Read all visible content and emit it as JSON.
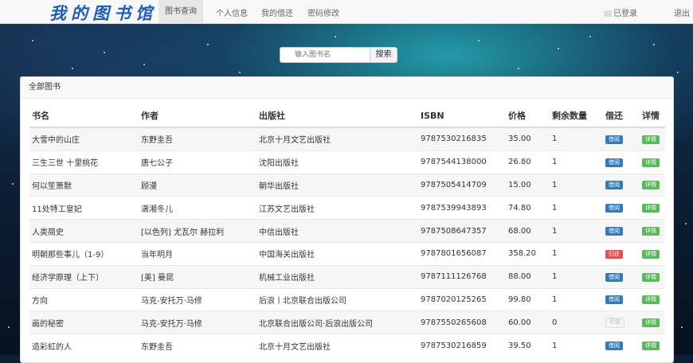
{
  "nav": {
    "brand": "我的图书馆",
    "links": [
      "图书查询",
      "个人信息",
      "我的借还",
      "密码修改"
    ],
    "user_status": "已登录",
    "logout": "退出"
  },
  "search": {
    "placeholder": "输入图书名",
    "button": "搜索"
  },
  "panel": {
    "title": "全部图书"
  },
  "table": {
    "headers": [
      "书名",
      "作者",
      "出版社",
      "ISBN",
      "价格",
      "剩余数量",
      "借还",
      "详情"
    ],
    "rows": [
      {
        "title": "大雪中的山庄",
        "author": "东野圭吾",
        "publisher": "北京十月文艺出版社",
        "isbn": "9787530216835",
        "price": "35.00",
        "stock": "1",
        "action": "借阅",
        "action_type": "borrow",
        "detail": "详情"
      },
      {
        "title": "三生三世 十里桃花",
        "author": "唐七公子",
        "publisher": "沈阳出版社",
        "isbn": "9787544138000",
        "price": "26.80",
        "stock": "1",
        "action": "借阅",
        "action_type": "borrow",
        "detail": "详情"
      },
      {
        "title": "何以笙箫默",
        "author": "顾漫",
        "publisher": "朝华出版社",
        "isbn": "9787505414709",
        "price": "15.00",
        "stock": "1",
        "action": "借阅",
        "action_type": "borrow",
        "detail": "详情"
      },
      {
        "title": "11处特工皇妃",
        "author": "潇湘冬儿",
        "publisher": "江苏文艺出版社",
        "isbn": "9787539943893",
        "price": "74.80",
        "stock": "1",
        "action": "借阅",
        "action_type": "borrow",
        "detail": "详情"
      },
      {
        "title": "人类简史",
        "author": "[以色列] 尤瓦尔 赫拉利",
        "publisher": "中信出版社",
        "isbn": "9787508647357",
        "price": "68.00",
        "stock": "1",
        "action": "借阅",
        "action_type": "borrow",
        "detail": "详情"
      },
      {
        "title": "明朝那些事儿（1-9）",
        "author": "当年明月",
        "publisher": "中国海关出版社",
        "isbn": "9787801656087",
        "price": "358.20",
        "stock": "1",
        "action": "归还",
        "action_type": "return",
        "detail": "详情"
      },
      {
        "title": "经济学原理（上下）",
        "author": "[美] 曼昆",
        "publisher": "机械工业出版社",
        "isbn": "9787111126768",
        "price": "88.00",
        "stock": "1",
        "action": "借阅",
        "action_type": "borrow",
        "detail": "详情"
      },
      {
        "title": "方向",
        "author": "马克-安托万·马修",
        "publisher": "后浪丨北京联合出版公司",
        "isbn": "9787020125265",
        "price": "99.80",
        "stock": "1",
        "action": "借阅",
        "action_type": "borrow",
        "detail": "详情"
      },
      {
        "title": "画的秘密",
        "author": "马克-安托万·马修",
        "publisher": "北京联合出版公司·后浪出版公司",
        "isbn": "9787550265608",
        "price": "60.00",
        "stock": "0",
        "action": "已空",
        "action_type": "empty",
        "detail": "详情"
      },
      {
        "title": "造彩虹的人",
        "author": "东野圭吾",
        "publisher": "北京十月文艺出版社",
        "isbn": "9787530216859",
        "price": "39.50",
        "stock": "1",
        "action": "借阅",
        "action_type": "borrow",
        "detail": "详情"
      }
    ]
  }
}
